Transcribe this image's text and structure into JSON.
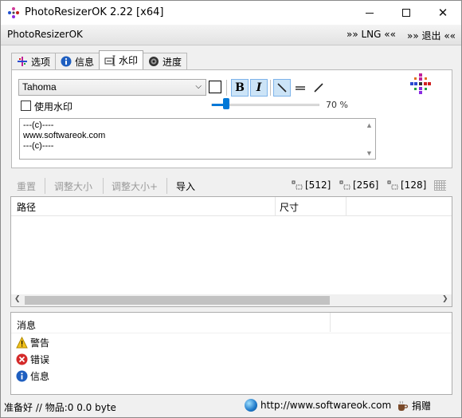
{
  "window": {
    "title": "PhotoResizerOK 2.22 [x64]",
    "minimize": "minimize",
    "maximize": "maximize",
    "close": "✕"
  },
  "menubar": {
    "app_label": "PhotoResizerOK",
    "language": "»» LNG ««",
    "exit": "»» 退出 ««"
  },
  "tabs": [
    {
      "label": "选项",
      "icon": "options-icon",
      "active": false
    },
    {
      "label": "信息",
      "icon": "info-icon",
      "active": false
    },
    {
      "label": "水印",
      "icon": "watermark-icon",
      "active": true
    },
    {
      "label": "进度",
      "icon": "progress-icon",
      "active": false
    }
  ],
  "watermark": {
    "font": "Tahoma",
    "bold_label": "B",
    "italic_label": "I",
    "use_watermark_label": "使用水印",
    "use_watermark_checked": false,
    "opacity_value": 70,
    "opacity_text": "70 %",
    "text_lines": [
      "---(c)----",
      "www.softwareok.com",
      "---(c)----"
    ]
  },
  "toolbar": {
    "reset": "重置",
    "resize": "调整大小",
    "resize_plus": "调整大小+",
    "import": "导入",
    "preset_512": "[512]",
    "preset_256": "[256]",
    "preset_128": "[128]"
  },
  "file_list": {
    "columns": [
      "路径",
      "尺寸"
    ],
    "rows": []
  },
  "messages": {
    "header": "消息",
    "items": [
      {
        "label": "警告",
        "icon": "warning-icon"
      },
      {
        "label": "错误",
        "icon": "error-icon"
      },
      {
        "label": "信息",
        "icon": "info-icon"
      }
    ]
  },
  "status": {
    "left": "准备好 // 物品:0 0.0 byte",
    "url": "http://www.softwareok.com",
    "donate": "捐赠"
  },
  "colors": {
    "accent": "#0078d7",
    "selected_bg": "#cce4f7",
    "selected_border": "#7eb4ea"
  }
}
